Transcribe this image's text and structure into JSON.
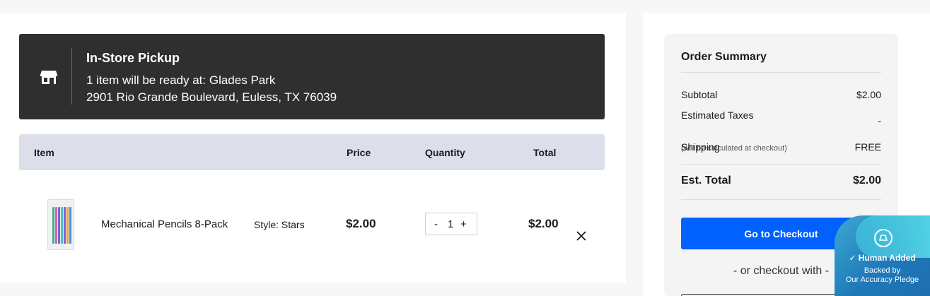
{
  "pickup": {
    "title": "In-Store Pickup",
    "line1": "1 item will be ready at: Glades Park",
    "line2": "2901 Rio Grande Boulevard, Euless, TX 76039",
    "icon": "store-icon"
  },
  "cart": {
    "columns": {
      "item": "Item",
      "price": "Price",
      "quantity": "Quantity",
      "total": "Total"
    },
    "items": [
      {
        "name": "Mechanical Pencils 8-Pack",
        "style_label": "Style:",
        "style_value": "Stars",
        "price": "$2.00",
        "qty_minus": "-",
        "quantity": "1",
        "qty_plus": "+",
        "total": "$2.00",
        "remove_icon": "close-icon"
      }
    ]
  },
  "summary": {
    "title": "Order Summary",
    "subtotal_label": "Subtotal",
    "subtotal_value": "$2.00",
    "taxes_label": "Estimated Taxes",
    "taxes_note": "(will be calculated at checkout)",
    "taxes_value": "-",
    "shipping_label": "Shipping",
    "shipping_value": "FREE",
    "est_total_label": "Est. Total",
    "est_total_value": "$2.00",
    "checkout_label": "Go to Checkout",
    "alt_checkout_text": "- or checkout with -"
  },
  "badge": {
    "title": "Human Added",
    "line1": "Backed by",
    "line2": "Our Accuracy Pledge"
  },
  "colors": {
    "pickup_bg": "#2f2f2f",
    "table_header_bg": "#dcdfea",
    "checkout_button": "#0061ff",
    "badge_bg": "#1e79b8"
  }
}
